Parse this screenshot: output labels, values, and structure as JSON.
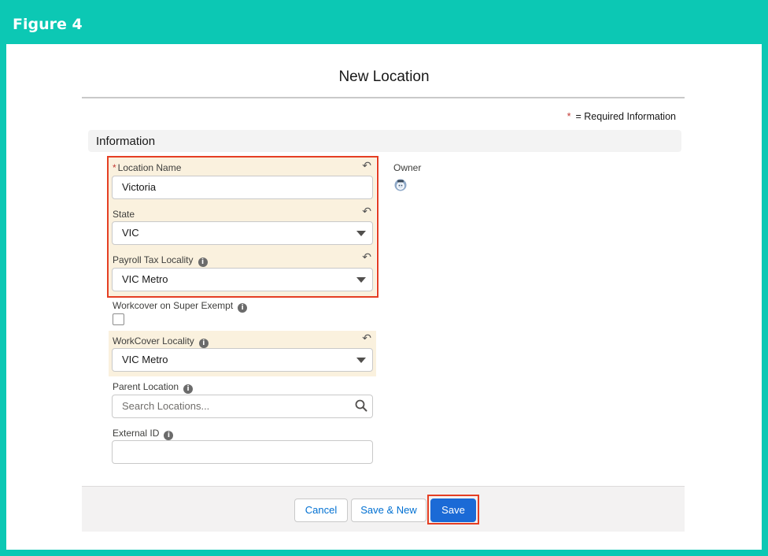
{
  "figure": {
    "title": "Figure 4"
  },
  "modal": {
    "title": "New Location",
    "required_star": "*",
    "required_text": "= Required Information"
  },
  "section": {
    "label": "Information"
  },
  "fields": {
    "location_name": {
      "required": "*",
      "label": "Location Name",
      "value": "Victoria"
    },
    "state": {
      "label": "State",
      "value": "VIC"
    },
    "payroll_tax_locality": {
      "label": "Payroll Tax Locality",
      "value": "VIC Metro"
    },
    "workcover_super_exempt": {
      "label": "Workcover on Super Exempt",
      "checked": false
    },
    "workcover_locality": {
      "label": "WorkCover Locality",
      "value": "VIC Metro"
    },
    "parent_location": {
      "label": "Parent Location",
      "placeholder": "Search Locations..."
    },
    "external_id": {
      "label": "External ID",
      "value": ""
    }
  },
  "owner": {
    "label": "Owner",
    "icon": "owner-avatar-icon"
  },
  "buttons": {
    "cancel": "Cancel",
    "save_new": "Save & New",
    "save": "Save"
  },
  "colors": {
    "frame": "#0cc8b4",
    "highlight": "#faf1de",
    "annotation_red": "#e53e23",
    "brand_blue": "#1b6ad6"
  },
  "glyphs": {
    "info": "i",
    "undo": "↶"
  }
}
